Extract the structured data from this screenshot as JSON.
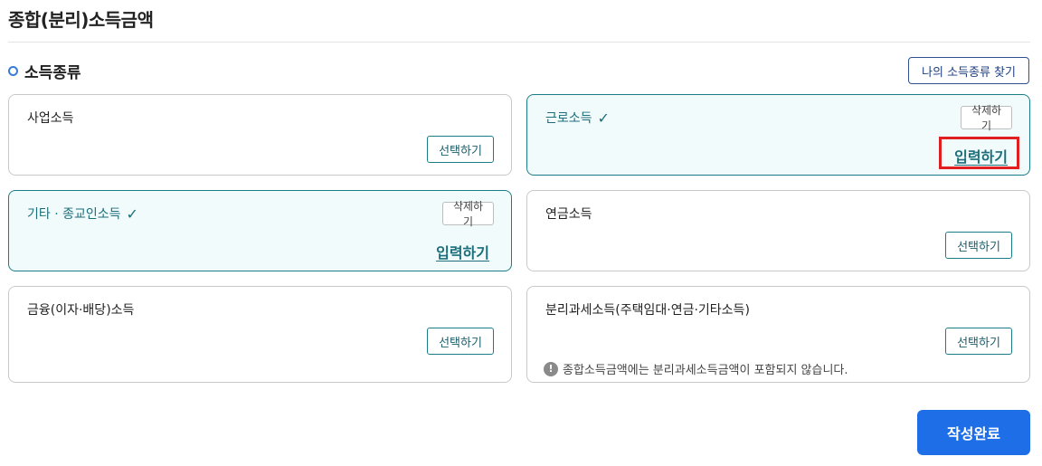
{
  "page": {
    "title": "종합(분리)소득금액"
  },
  "section": {
    "title": "소득종류",
    "find_button": "나의 소득종류 찾기"
  },
  "cards": {
    "business": {
      "label": "사업소득",
      "action": "선택하기"
    },
    "earned": {
      "label": "근로소득",
      "delete": "삭제하기",
      "input": "입력하기",
      "selected": true
    },
    "other_religious": {
      "label": "기타 · 종교인소득",
      "delete": "삭제하기",
      "input": "입력하기",
      "selected": true
    },
    "pension": {
      "label": "연금소득",
      "action": "선택하기"
    },
    "financial": {
      "label": "금융(이자·배당)소득",
      "action": "선택하기"
    },
    "separate": {
      "label": "분리과세소득(주택임대·연금·기타소득)",
      "action": "선택하기",
      "note": "종합소득금액에는 분리과세소득금액이 포함되지 않습니다."
    }
  },
  "icons": {
    "check": "check-icon",
    "info": "info-icon",
    "bullet": "circle-bullet-icon"
  },
  "colors": {
    "accent": "#1b7e86",
    "primary": "#1e6ee8",
    "highlight": "#e02020"
  },
  "footer": {
    "submit": "작성완료"
  }
}
